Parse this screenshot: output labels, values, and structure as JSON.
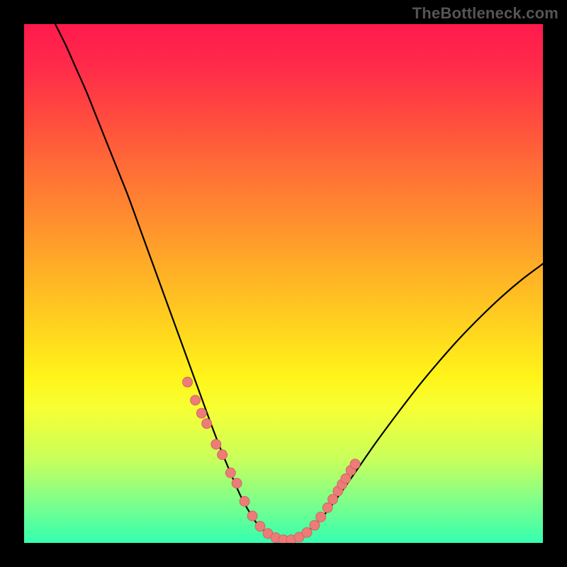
{
  "watermark": "TheBottleneck.com",
  "colors": {
    "curve": "#000000",
    "marker_fill": "#ed7b78",
    "marker_stroke": "#c95e5b"
  },
  "chart_data": {
    "type": "line",
    "title": "",
    "xlabel": "",
    "ylabel": "",
    "xlim": [
      0,
      100
    ],
    "ylim": [
      0,
      100
    ],
    "grid": false,
    "series": [
      {
        "name": "bottleneck-curve",
        "x": [
          6,
          8,
          10,
          12,
          14,
          16,
          18,
          20,
          22,
          24,
          26,
          28,
          30,
          32,
          34,
          36,
          38,
          40,
          42,
          44,
          45,
          46,
          47,
          48,
          49,
          50,
          51,
          52,
          53,
          54,
          56,
          58,
          60,
          62,
          65,
          68,
          72,
          76,
          80,
          84,
          88,
          92,
          96,
          100
        ],
        "values": [
          100,
          96,
          91.5,
          87,
          82,
          77,
          72,
          67,
          61.5,
          56,
          50.5,
          45,
          39.5,
          34,
          28.5,
          23,
          17.8,
          13,
          8.5,
          5,
          3.6,
          2.6,
          1.8,
          1.2,
          0.8,
          0.5,
          0.5,
          0.7,
          1.1,
          1.7,
          3.4,
          5.6,
          8.2,
          11,
          15.3,
          19.6,
          25,
          30.2,
          35,
          39.5,
          43.6,
          47.4,
          50.8,
          53.8
        ]
      }
    ],
    "markers": {
      "name": "sample-points",
      "x": [
        31.5,
        33,
        34.2,
        35.2,
        37,
        38.2,
        39.8,
        41,
        42.5,
        44,
        45.5,
        47,
        48.5,
        50,
        51.5,
        53,
        54.5,
        56,
        57.2,
        58.5,
        59.5,
        60.5,
        61.3,
        62,
        63,
        63.8
      ],
      "values": [
        31,
        27.5,
        25,
        23,
        19,
        17,
        13.5,
        11.5,
        8,
        5.2,
        3.2,
        1.8,
        1,
        0.6,
        0.6,
        1.1,
        2,
        3.4,
        5,
        6.8,
        8.4,
        10,
        11.3,
        12.4,
        14,
        15.2
      ]
    }
  }
}
